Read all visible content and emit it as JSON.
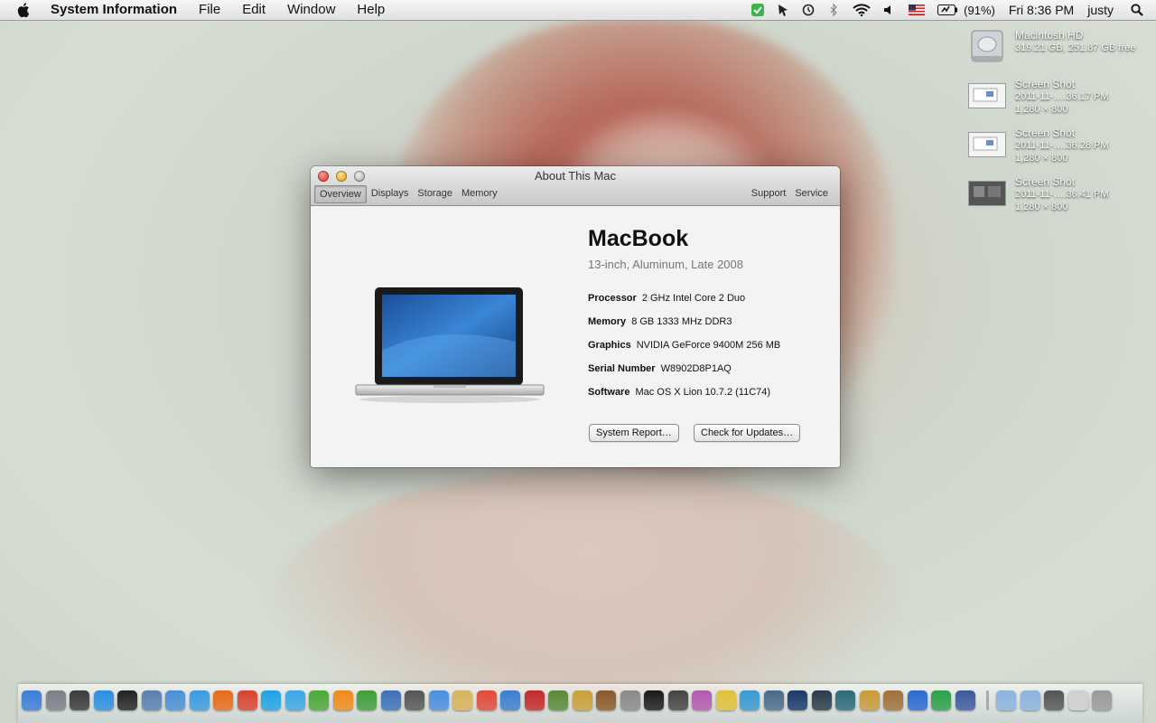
{
  "menubar": {
    "app_name": "System Information",
    "menus": [
      "File",
      "Edit",
      "Window",
      "Help"
    ],
    "battery": "(91%)",
    "clock": "Fri 8:36 PM",
    "user": "justy",
    "status_icons": [
      "checkmark-icon",
      "cursor-icon",
      "time-machine-icon",
      "bluetooth-icon",
      "wifi-icon",
      "volume-icon",
      "flag-icon",
      "battery-icon"
    ]
  },
  "desktop": [
    {
      "title": "Macintosh HD",
      "line1": "319.21 GB, 251.87 GB free",
      "line2": ""
    },
    {
      "title": "Screen Shot",
      "line1": "2011-11-….36.17 PM",
      "line2": "1,280 × 800"
    },
    {
      "title": "Screen Shot",
      "line1": "2011-11-….36.28 PM",
      "line2": "1,280 × 800"
    },
    {
      "title": "Screen Shot",
      "line1": "2011-11-….36.41 PM",
      "line2": "1,280 × 800"
    }
  ],
  "window": {
    "title": "About This Mac",
    "tabs_left": [
      "Overview",
      "Displays",
      "Storage",
      "Memory"
    ],
    "tabs_right": [
      "Support",
      "Service"
    ],
    "model": "MacBook",
    "model_sub": "13-inch, Aluminum, Late 2008",
    "specs": [
      {
        "label": "Processor",
        "value": "2 GHz Intel Core 2 Duo"
      },
      {
        "label": "Memory",
        "value": "8 GB 1333 MHz DDR3"
      },
      {
        "label": "Graphics",
        "value": "NVIDIA GeForce 9400M 256 MB"
      },
      {
        "label": "Serial Number",
        "value": "W8902D8P1AQ"
      },
      {
        "label": "Software",
        "value": "Mac OS X Lion 10.7.2 (11C74)"
      }
    ],
    "buttons": [
      "System Report…",
      "Check for Updates…"
    ]
  },
  "dock": {
    "icons": [
      {
        "name": "finder-icon",
        "color": "#3b7dd8"
      },
      {
        "name": "launchpad-icon",
        "color": "#7a7f88"
      },
      {
        "name": "mission-control-icon",
        "color": "#3a3a3a"
      },
      {
        "name": "app-store-icon",
        "color": "#2d8fe0"
      },
      {
        "name": "dashboard-icon",
        "color": "#222222"
      },
      {
        "name": "preview-icon",
        "color": "#5a7fb0"
      },
      {
        "name": "mail-icon",
        "color": "#4b8fd6"
      },
      {
        "name": "safari-icon",
        "color": "#3a9be0"
      },
      {
        "name": "firefox-icon",
        "color": "#e86a1c"
      },
      {
        "name": "chrome-icon",
        "color": "#d9412f"
      },
      {
        "name": "skype-icon",
        "color": "#1fa3e2"
      },
      {
        "name": "twitter-icon",
        "color": "#3aa7e6"
      },
      {
        "name": "adium-icon",
        "color": "#4aa83a"
      },
      {
        "name": "vlc-icon",
        "color": "#f08a1a"
      },
      {
        "name": "utorrent-icon",
        "color": "#3f9d3a"
      },
      {
        "name": "xcode-icon",
        "color": "#3b70b8"
      },
      {
        "name": "facetime-icon",
        "color": "#555555"
      },
      {
        "name": "messages-icon",
        "color": "#4a8fe0"
      },
      {
        "name": "notes-icon",
        "color": "#d9b45a"
      },
      {
        "name": "calendar-icon",
        "color": "#e04a3a"
      },
      {
        "name": "itunes-icon",
        "color": "#3a7fd0"
      },
      {
        "name": "photo-booth-icon",
        "color": "#c22a2a"
      },
      {
        "name": "iphoto-icon",
        "color": "#5a8a3a"
      },
      {
        "name": "sparkle-icon",
        "color": "#c9a23a"
      },
      {
        "name": "garageband-icon",
        "color": "#8a5a2a"
      },
      {
        "name": "system-prefs-icon",
        "color": "#8a8a8a"
      },
      {
        "name": "terminal-icon",
        "color": "#1a1a1a"
      },
      {
        "name": "pause-icon",
        "color": "#444444"
      },
      {
        "name": "octopus-icon",
        "color": "#b45ab0"
      },
      {
        "name": "sticky-icon",
        "color": "#e0c23a"
      },
      {
        "name": "hand-icon",
        "color": "#3a9ad0"
      },
      {
        "name": "monitor-icon",
        "color": "#4a6a8a"
      },
      {
        "name": "league-icon",
        "color": "#1a3a6a"
      },
      {
        "name": "steam-icon",
        "color": "#2a3a4a"
      },
      {
        "name": "globe-icon",
        "color": "#2a6a7a"
      },
      {
        "name": "archive-icon",
        "color": "#c99a3a"
      },
      {
        "name": "coffee-icon",
        "color": "#a0703a"
      },
      {
        "name": "word-icon",
        "color": "#2a6ad0"
      },
      {
        "name": "excel-icon",
        "color": "#2aa04a"
      },
      {
        "name": "imovie-icon",
        "color": "#3a5a9a"
      },
      {
        "name": "separator-icon",
        "color": "#aaaaaa"
      },
      {
        "name": "applications-folder-icon",
        "color": "#8ab4e0"
      },
      {
        "name": "documents-folder-icon",
        "color": "#8ab4e0"
      },
      {
        "name": "downloads-stack-icon",
        "color": "#555555"
      },
      {
        "name": "screenshots-stack-icon",
        "color": "#d0d0d0"
      },
      {
        "name": "trash-icon",
        "color": "#9a9a9a"
      }
    ]
  }
}
